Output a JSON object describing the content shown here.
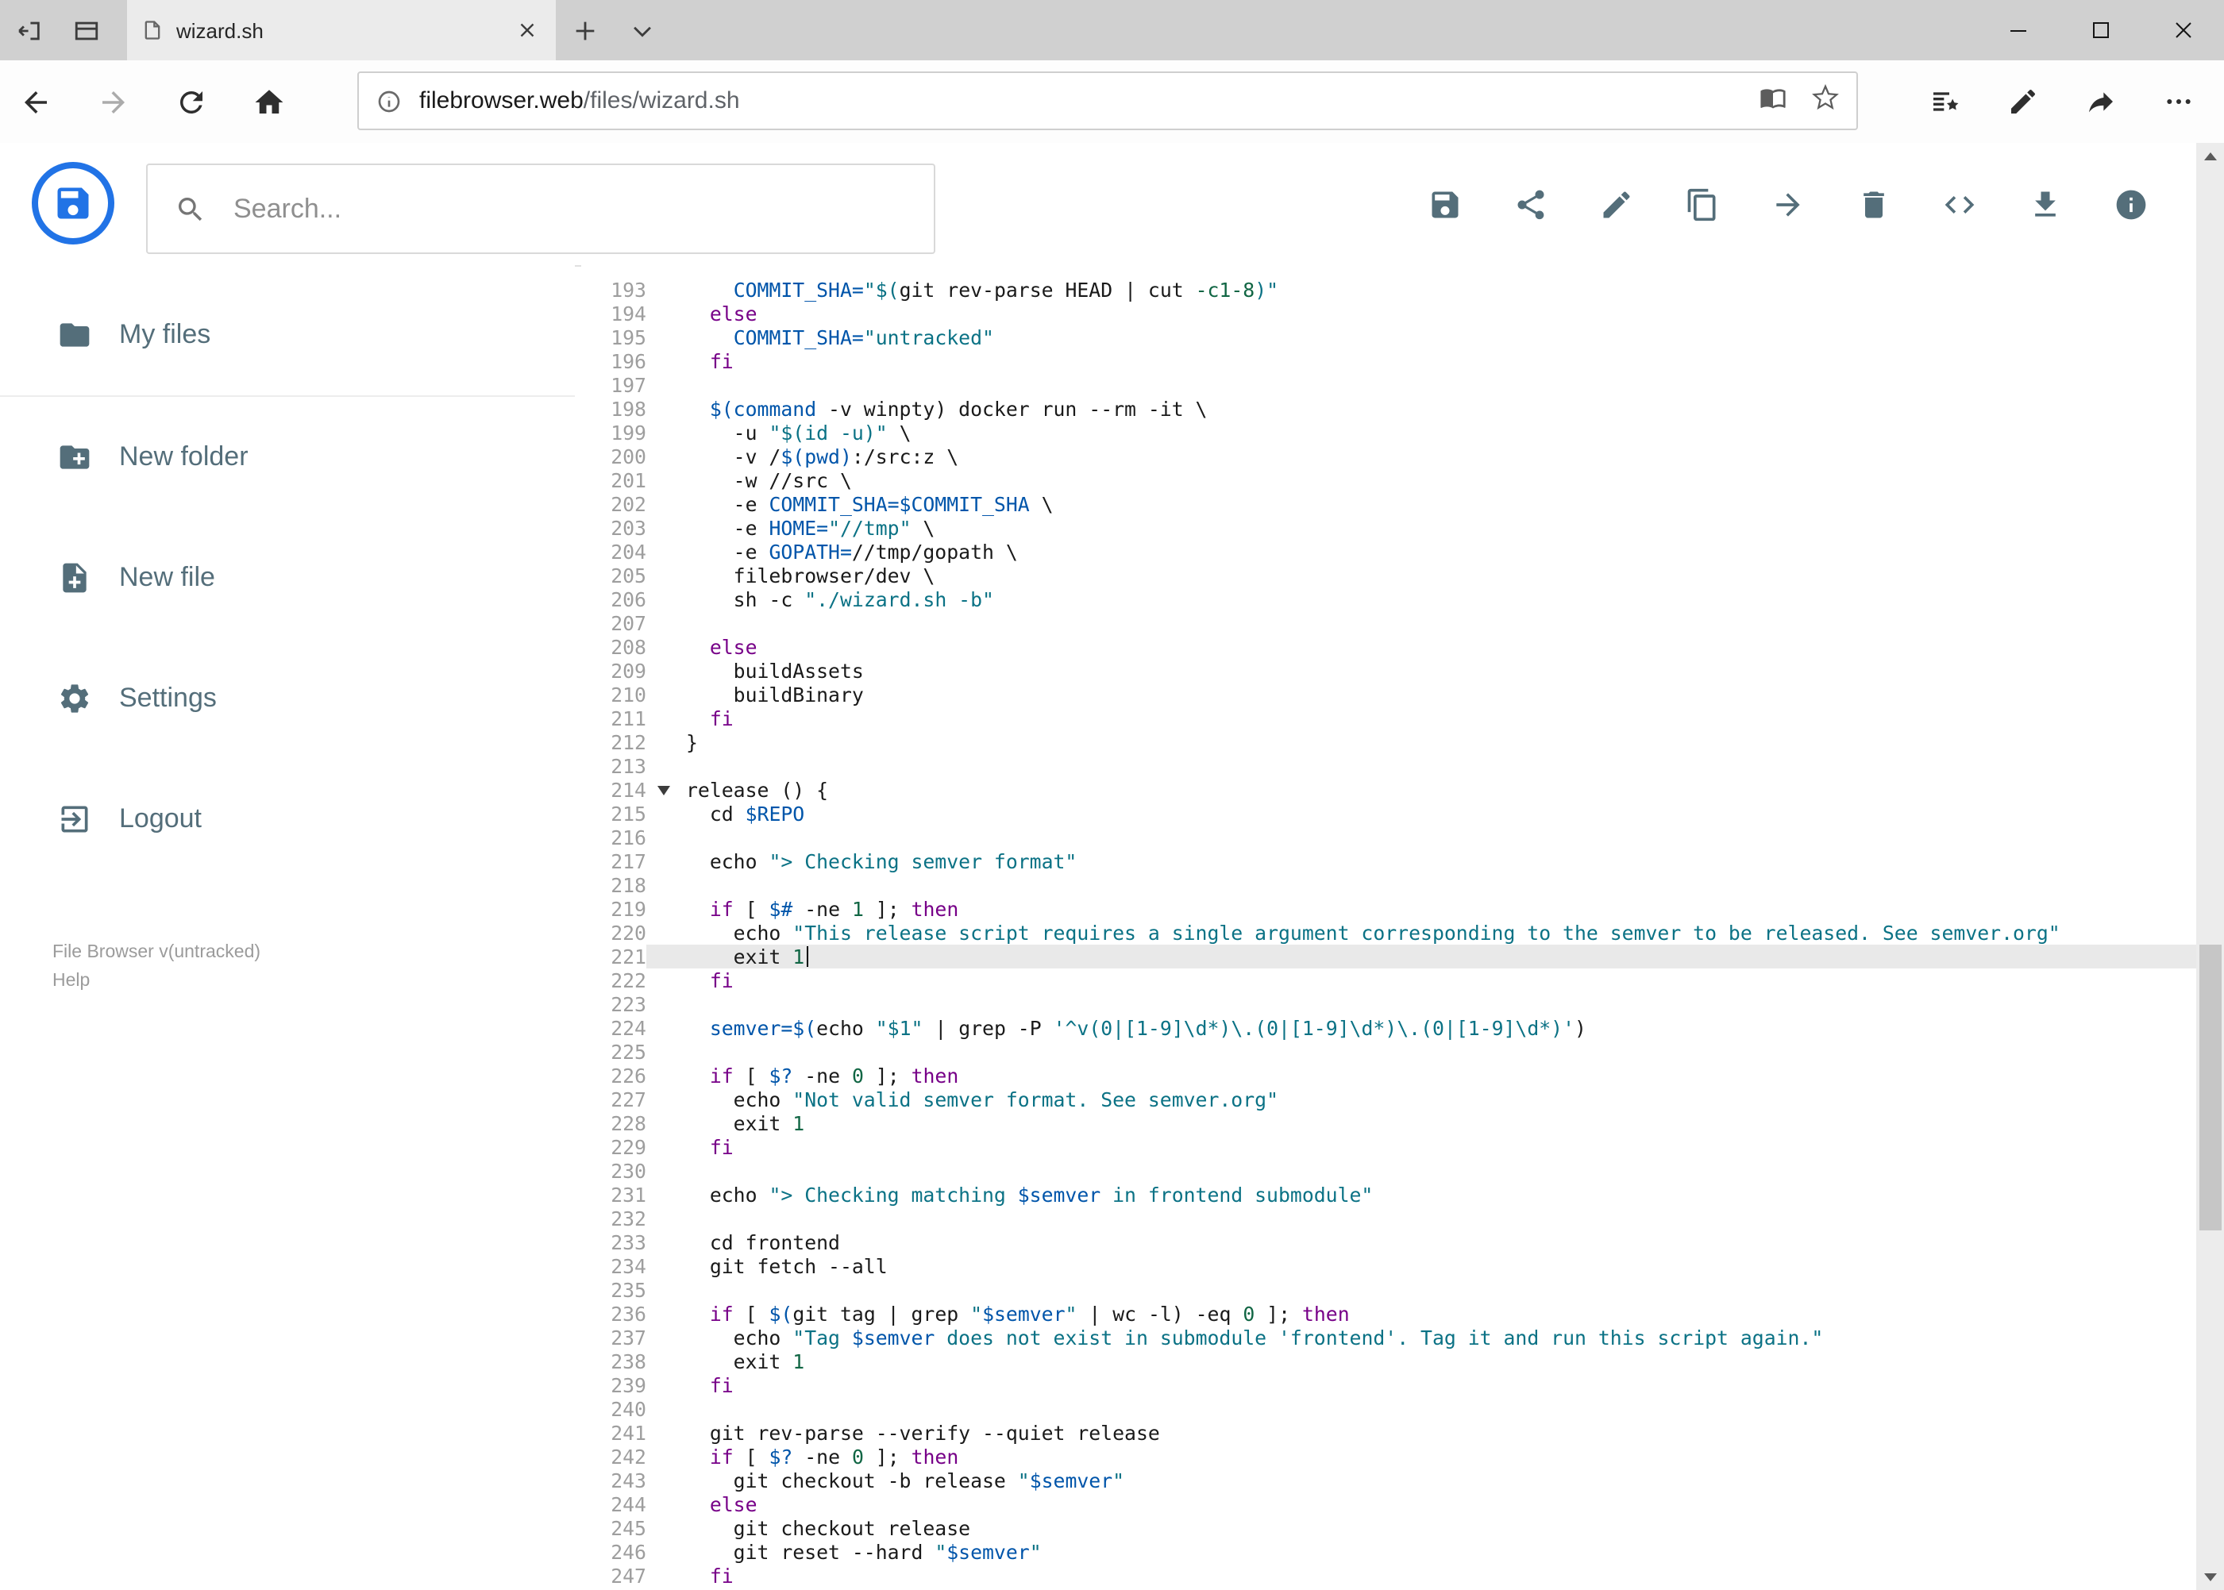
{
  "browser": {
    "tab_title": "wizard.sh",
    "url_domain": "filebrowser.web",
    "url_path": "/files/wizard.sh",
    "window_controls": [
      "minimize",
      "maximize",
      "close"
    ],
    "nav_icons": [
      "back",
      "forward",
      "refresh",
      "home"
    ],
    "address_bar_icons": [
      "info",
      "reading-view",
      "favorite-star"
    ],
    "toolbar_icons": [
      "hub-favorites",
      "web-note-pen",
      "share",
      "more"
    ]
  },
  "header": {
    "search_placeholder": "Search...",
    "action_icons": [
      "save",
      "share",
      "rename",
      "copy",
      "move",
      "delete",
      "raw-code",
      "download",
      "info"
    ]
  },
  "sidebar": {
    "items": [
      {
        "label": "My files",
        "icon": "folder"
      },
      {
        "label": "New folder",
        "icon": "new-folder"
      },
      {
        "label": "New file",
        "icon": "new-file"
      },
      {
        "label": "Settings",
        "icon": "settings-gear"
      },
      {
        "label": "Logout",
        "icon": "logout"
      }
    ],
    "footer": {
      "version": "File Browser v(untracked)",
      "help": "Help"
    }
  },
  "editor": {
    "active_line": 221,
    "fold_marker_line": 214,
    "lines": [
      {
        "n": 193,
        "seg": [
          [
            "p",
            "    "
          ],
          [
            "v",
            "COMMIT_SHA="
          ],
          [
            "s",
            "\"$("
          ],
          [
            "p",
            "git rev-parse HEAD | cut "
          ],
          [
            "n",
            "-c1-8"
          ],
          [
            "s",
            ")\""
          ]
        ]
      },
      {
        "n": 194,
        "seg": [
          [
            "p",
            "  "
          ],
          [
            "k",
            "else"
          ]
        ]
      },
      {
        "n": 195,
        "seg": [
          [
            "p",
            "    "
          ],
          [
            "v",
            "COMMIT_SHA="
          ],
          [
            "s",
            "\"untracked\""
          ]
        ]
      },
      {
        "n": 196,
        "seg": [
          [
            "p",
            "  "
          ],
          [
            "k",
            "fi"
          ]
        ]
      },
      {
        "n": 197,
        "seg": []
      },
      {
        "n": 198,
        "seg": [
          [
            "p",
            "  "
          ],
          [
            "v",
            "$(command"
          ],
          [
            "p",
            " -v winpty) docker run --rm -it \\"
          ]
        ]
      },
      {
        "n": 199,
        "seg": [
          [
            "p",
            "    -u "
          ],
          [
            "s",
            "\"$(id -u)\""
          ],
          [
            "p",
            " \\"
          ]
        ]
      },
      {
        "n": 200,
        "seg": [
          [
            "p",
            "    -v /"
          ],
          [
            "v",
            "$(pwd)"
          ],
          [
            "p",
            ":/src:z \\"
          ]
        ]
      },
      {
        "n": 201,
        "seg": [
          [
            "p",
            "    -w //src \\"
          ]
        ]
      },
      {
        "n": 202,
        "seg": [
          [
            "p",
            "    -e "
          ],
          [
            "v",
            "COMMIT_SHA=$COMMIT_SHA"
          ],
          [
            "p",
            " \\"
          ]
        ]
      },
      {
        "n": 203,
        "seg": [
          [
            "p",
            "    -e "
          ],
          [
            "v",
            "HOME="
          ],
          [
            "s",
            "\"//tmp\""
          ],
          [
            "p",
            " \\"
          ]
        ]
      },
      {
        "n": 204,
        "seg": [
          [
            "p",
            "    -e "
          ],
          [
            "v",
            "GOPATH="
          ],
          [
            "p",
            "//tmp/gopath \\"
          ]
        ]
      },
      {
        "n": 205,
        "seg": [
          [
            "p",
            "    filebrowser/dev \\"
          ]
        ]
      },
      {
        "n": 206,
        "seg": [
          [
            "p",
            "    sh -c "
          ],
          [
            "s",
            "\"./wizard.sh -b\""
          ]
        ]
      },
      {
        "n": 207,
        "seg": []
      },
      {
        "n": 208,
        "seg": [
          [
            "p",
            "  "
          ],
          [
            "k",
            "else"
          ]
        ]
      },
      {
        "n": 209,
        "seg": [
          [
            "p",
            "    buildAssets"
          ]
        ]
      },
      {
        "n": 210,
        "seg": [
          [
            "p",
            "    buildBinary"
          ]
        ]
      },
      {
        "n": 211,
        "seg": [
          [
            "p",
            "  "
          ],
          [
            "k",
            "fi"
          ]
        ]
      },
      {
        "n": 212,
        "seg": [
          [
            "p",
            "}"
          ]
        ]
      },
      {
        "n": 213,
        "seg": []
      },
      {
        "n": 214,
        "seg": [
          [
            "p",
            "release () {"
          ]
        ]
      },
      {
        "n": 215,
        "seg": [
          [
            "p",
            "  cd "
          ],
          [
            "v",
            "$REPO"
          ]
        ]
      },
      {
        "n": 216,
        "seg": []
      },
      {
        "n": 217,
        "seg": [
          [
            "p",
            "  echo "
          ],
          [
            "s",
            "\"> Checking semver format\""
          ]
        ]
      },
      {
        "n": 218,
        "seg": []
      },
      {
        "n": 219,
        "seg": [
          [
            "p",
            "  "
          ],
          [
            "k",
            "if"
          ],
          [
            "p",
            " [ "
          ],
          [
            "v",
            "$#"
          ],
          [
            "p",
            " -ne "
          ],
          [
            "n",
            "1"
          ],
          [
            "p",
            " ]; "
          ],
          [
            "k",
            "then"
          ]
        ]
      },
      {
        "n": 220,
        "seg": [
          [
            "p",
            "    echo "
          ],
          [
            "s",
            "\"This release script requires a single argument corresponding to the semver to be released. See semver.org\""
          ]
        ]
      },
      {
        "n": 221,
        "seg": [
          [
            "p",
            "    exit "
          ],
          [
            "n",
            "1"
          ]
        ]
      },
      {
        "n": 222,
        "seg": [
          [
            "p",
            "  "
          ],
          [
            "k",
            "fi"
          ]
        ]
      },
      {
        "n": 223,
        "seg": []
      },
      {
        "n": 224,
        "seg": [
          [
            "p",
            "  "
          ],
          [
            "v",
            "semver=$("
          ],
          [
            "p",
            "echo "
          ],
          [
            "s",
            "\"$1\""
          ],
          [
            "p",
            " | grep -P "
          ],
          [
            "s",
            "'^v(0|[1-9]\\d*)\\.(0|[1-9]\\d*)\\.(0|[1-9]\\d*)'"
          ],
          [
            "p",
            ")"
          ]
        ]
      },
      {
        "n": 225,
        "seg": []
      },
      {
        "n": 226,
        "seg": [
          [
            "p",
            "  "
          ],
          [
            "k",
            "if"
          ],
          [
            "p",
            " [ "
          ],
          [
            "v",
            "$?"
          ],
          [
            "p",
            " -ne "
          ],
          [
            "n",
            "0"
          ],
          [
            "p",
            " ]; "
          ],
          [
            "k",
            "then"
          ]
        ]
      },
      {
        "n": 227,
        "seg": [
          [
            "p",
            "    echo "
          ],
          [
            "s",
            "\"Not valid semver format. See semver.org\""
          ]
        ]
      },
      {
        "n": 228,
        "seg": [
          [
            "p",
            "    exit "
          ],
          [
            "n",
            "1"
          ]
        ]
      },
      {
        "n": 229,
        "seg": [
          [
            "p",
            "  "
          ],
          [
            "k",
            "fi"
          ]
        ]
      },
      {
        "n": 230,
        "seg": []
      },
      {
        "n": 231,
        "seg": [
          [
            "p",
            "  echo "
          ],
          [
            "s",
            "\"> Checking matching "
          ],
          [
            "v",
            "$semver"
          ],
          [
            "s",
            " in frontend submodule\""
          ]
        ]
      },
      {
        "n": 232,
        "seg": []
      },
      {
        "n": 233,
        "seg": [
          [
            "p",
            "  cd frontend"
          ]
        ]
      },
      {
        "n": 234,
        "seg": [
          [
            "p",
            "  git fetch --all"
          ]
        ]
      },
      {
        "n": 235,
        "seg": []
      },
      {
        "n": 236,
        "seg": [
          [
            "p",
            "  "
          ],
          [
            "k",
            "if"
          ],
          [
            "p",
            " [ "
          ],
          [
            "v",
            "$("
          ],
          [
            "p",
            "git tag | grep "
          ],
          [
            "s",
            "\""
          ],
          [
            "v",
            "$semver"
          ],
          [
            "s",
            "\""
          ],
          [
            "p",
            " | wc -l) -eq "
          ],
          [
            "n",
            "0"
          ],
          [
            "p",
            " ]; "
          ],
          [
            "k",
            "then"
          ]
        ]
      },
      {
        "n": 237,
        "seg": [
          [
            "p",
            "    echo "
          ],
          [
            "s",
            "\"Tag "
          ],
          [
            "v",
            "$semver"
          ],
          [
            "s",
            " does not exist in submodule 'frontend'. Tag it and run this script again.\""
          ]
        ]
      },
      {
        "n": 238,
        "seg": [
          [
            "p",
            "    exit "
          ],
          [
            "n",
            "1"
          ]
        ]
      },
      {
        "n": 239,
        "seg": [
          [
            "p",
            "  "
          ],
          [
            "k",
            "fi"
          ]
        ]
      },
      {
        "n": 240,
        "seg": []
      },
      {
        "n": 241,
        "seg": [
          [
            "p",
            "  git rev-parse --verify --quiet release"
          ]
        ]
      },
      {
        "n": 242,
        "seg": [
          [
            "p",
            "  "
          ],
          [
            "k",
            "if"
          ],
          [
            "p",
            " [ "
          ],
          [
            "v",
            "$?"
          ],
          [
            "p",
            " -ne "
          ],
          [
            "n",
            "0"
          ],
          [
            "p",
            " ]; "
          ],
          [
            "k",
            "then"
          ]
        ]
      },
      {
        "n": 243,
        "seg": [
          [
            "p",
            "    git checkout -b release "
          ],
          [
            "s",
            "\""
          ],
          [
            "v",
            "$semver"
          ],
          [
            "s",
            "\""
          ]
        ]
      },
      {
        "n": 244,
        "seg": [
          [
            "p",
            "  "
          ],
          [
            "k",
            "else"
          ]
        ]
      },
      {
        "n": 245,
        "seg": [
          [
            "p",
            "    git checkout release"
          ]
        ]
      },
      {
        "n": 246,
        "seg": [
          [
            "p",
            "    git reset --hard "
          ],
          [
            "s",
            "\""
          ],
          [
            "v",
            "$semver"
          ],
          [
            "s",
            "\""
          ]
        ]
      },
      {
        "n": 247,
        "seg": [
          [
            "p",
            "  "
          ],
          [
            "k",
            "fi"
          ]
        ]
      }
    ]
  },
  "colors": {
    "accent": "#2173e6",
    "sidebar-fg": "#546e7a",
    "keyword": "#770088",
    "string": "#0b7285",
    "variable": "#0055aa",
    "number": "#116644",
    "active-line-bg": "#e9e9e9"
  }
}
